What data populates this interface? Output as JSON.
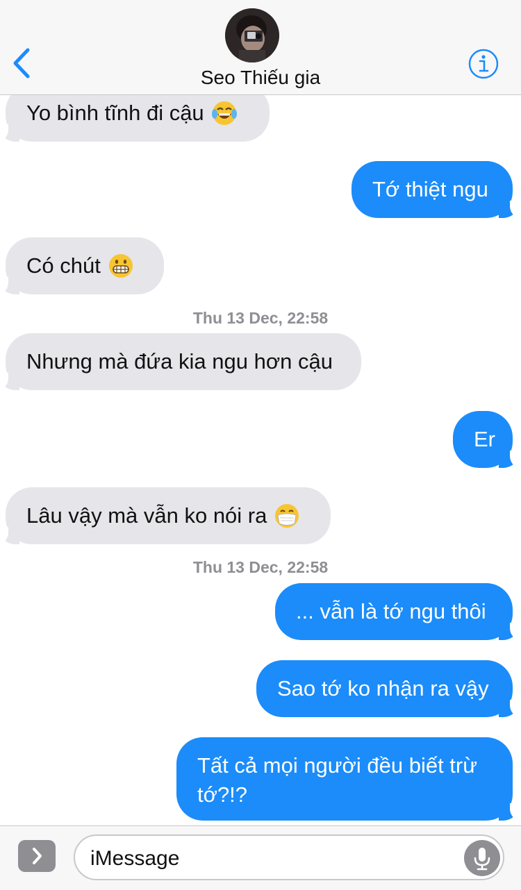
{
  "header": {
    "contact_name": "Seo Thiếu gia",
    "back_icon": "chevron-left-icon",
    "info_icon": "info-icon",
    "accent_color": "#1b8cfa"
  },
  "messages": [
    {
      "direction": "incoming",
      "text": "Yo bình tĩnh đi cậu",
      "emoji": "tears-of-joy-emoji"
    },
    {
      "direction": "outgoing",
      "text": "Tớ thiệt ngu"
    },
    {
      "direction": "incoming",
      "text": "Có chút",
      "emoji": "grimacing-emoji"
    },
    {
      "timestamp": "Thu 13 Dec, 22:58"
    },
    {
      "direction": "incoming",
      "text": "Nhưng mà đứa kia ngu hơn cậu"
    },
    {
      "direction": "outgoing",
      "text": "Er"
    },
    {
      "direction": "incoming",
      "text": "Lâu vậy mà vẫn ko nói ra",
      "emoji": "face-with-mask-emoji"
    },
    {
      "timestamp": "Thu 13 Dec, 22:58"
    },
    {
      "direction": "outgoing",
      "text": "... vẫn là tớ ngu thôi"
    },
    {
      "direction": "outgoing",
      "text": "Sao tớ ko nhận ra vậy"
    },
    {
      "direction": "outgoing",
      "text": "Tất cả mọi người đều biết trừ tớ?!?"
    }
  ],
  "composer": {
    "placeholder": "iMessage",
    "apps_icon": "chevron-right-icon",
    "mic_icon": "microphone-icon"
  },
  "colors": {
    "incoming_bubble": "#e5e5ea",
    "outgoing_bubble": "#1b8cfa",
    "timestamp_text": "#8e8e93"
  }
}
